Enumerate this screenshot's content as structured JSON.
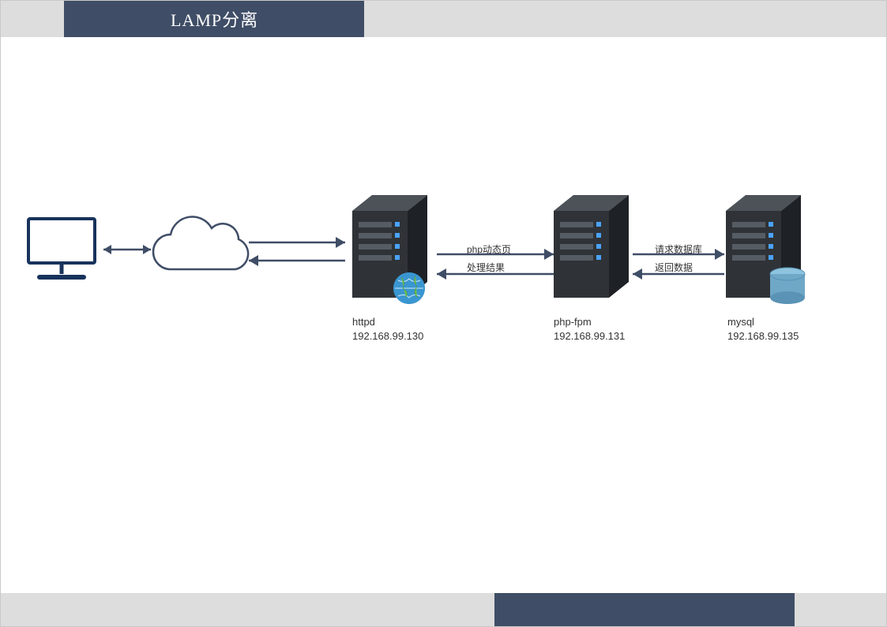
{
  "title": "LAMP分离",
  "nodes": {
    "client": {
      "kind": "monitor"
    },
    "cloud": {
      "kind": "cloud"
    },
    "httpd": {
      "kind": "server-globe",
      "name": "httpd",
      "ip": "192.168.99.130"
    },
    "phpfpm": {
      "kind": "server",
      "name": "php-fpm",
      "ip": "192.168.99.131"
    },
    "mysql": {
      "kind": "server-db",
      "name": "mysql",
      "ip": "192.168.99.135"
    }
  },
  "edges": {
    "client_cloud": {
      "label_fwd": "",
      "label_back": ""
    },
    "cloud_httpd": {
      "label_fwd": "",
      "label_back": ""
    },
    "httpd_phpfpm": {
      "label_fwd": "php动态页",
      "label_back": "处理结果"
    },
    "phpfpm_mysql": {
      "label_fwd": "请求数据库",
      "label_back": "返回数据"
    }
  },
  "colors": {
    "accent": "#3f4d66",
    "server_dark": "#2f3337",
    "server_light": "#4c5258",
    "db": "#6fa7c7"
  }
}
